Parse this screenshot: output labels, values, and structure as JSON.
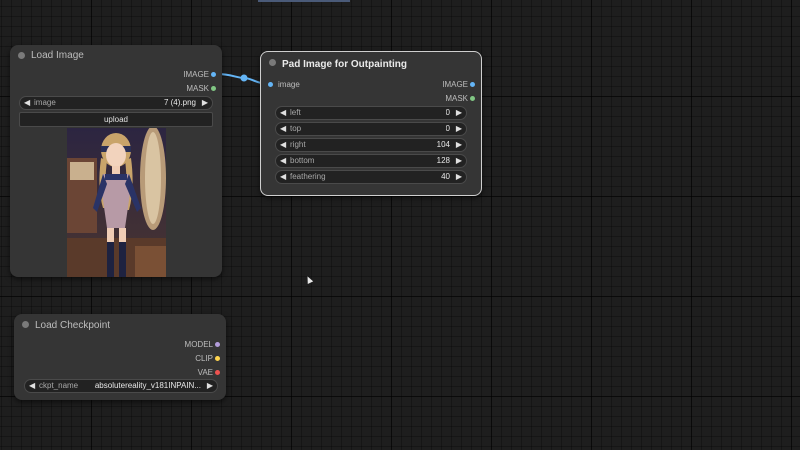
{
  "colors": {
    "image_slot": "#64b5f6",
    "mask_slot": "#81c784",
    "model_slot": "#b39ddb",
    "clip_slot": "#ffd54f",
    "vae_slot": "#ef5350",
    "link": "#64b5f6"
  },
  "load_image": {
    "title": "Load Image",
    "outputs": [
      "IMAGE",
      "MASK"
    ],
    "widget": {
      "label": "image",
      "value": "7 (4).png"
    },
    "upload_label": "upload"
  },
  "pad_image": {
    "title": "Pad Image for Outpainting",
    "input": "image",
    "outputs": [
      "IMAGE",
      "MASK"
    ],
    "widgets": [
      {
        "label": "left",
        "value": "0"
      },
      {
        "label": "top",
        "value": "0"
      },
      {
        "label": "right",
        "value": "104"
      },
      {
        "label": "bottom",
        "value": "128"
      },
      {
        "label": "feathering",
        "value": "40"
      }
    ]
  },
  "load_checkpoint": {
    "title": "Load Checkpoint",
    "outputs": [
      "MODEL",
      "CLIP",
      "VAE"
    ],
    "widget": {
      "label": "ckpt_name",
      "value": "absolutereality_v181INPAIN..."
    }
  }
}
